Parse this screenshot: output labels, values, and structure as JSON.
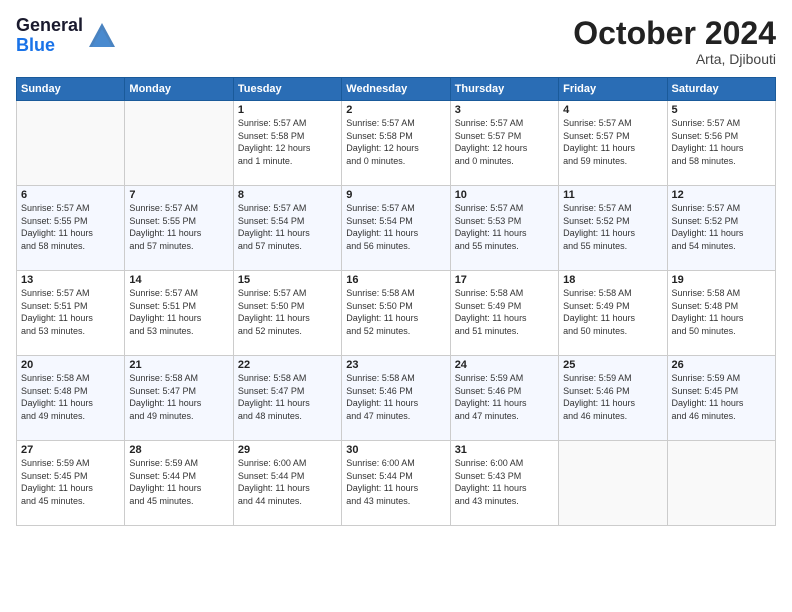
{
  "logo": {
    "line1": "General",
    "line2": "Blue"
  },
  "header": {
    "title": "October 2024",
    "location": "Arta, Djibouti"
  },
  "weekdays": [
    "Sunday",
    "Monday",
    "Tuesday",
    "Wednesday",
    "Thursday",
    "Friday",
    "Saturday"
  ],
  "weeks": [
    [
      {
        "day": "",
        "info": ""
      },
      {
        "day": "",
        "info": ""
      },
      {
        "day": "1",
        "info": "Sunrise: 5:57 AM\nSunset: 5:58 PM\nDaylight: 12 hours\nand 1 minute."
      },
      {
        "day": "2",
        "info": "Sunrise: 5:57 AM\nSunset: 5:58 PM\nDaylight: 12 hours\nand 0 minutes."
      },
      {
        "day": "3",
        "info": "Sunrise: 5:57 AM\nSunset: 5:57 PM\nDaylight: 12 hours\nand 0 minutes."
      },
      {
        "day": "4",
        "info": "Sunrise: 5:57 AM\nSunset: 5:57 PM\nDaylight: 11 hours\nand 59 minutes."
      },
      {
        "day": "5",
        "info": "Sunrise: 5:57 AM\nSunset: 5:56 PM\nDaylight: 11 hours\nand 58 minutes."
      }
    ],
    [
      {
        "day": "6",
        "info": "Sunrise: 5:57 AM\nSunset: 5:55 PM\nDaylight: 11 hours\nand 58 minutes."
      },
      {
        "day": "7",
        "info": "Sunrise: 5:57 AM\nSunset: 5:55 PM\nDaylight: 11 hours\nand 57 minutes."
      },
      {
        "day": "8",
        "info": "Sunrise: 5:57 AM\nSunset: 5:54 PM\nDaylight: 11 hours\nand 57 minutes."
      },
      {
        "day": "9",
        "info": "Sunrise: 5:57 AM\nSunset: 5:54 PM\nDaylight: 11 hours\nand 56 minutes."
      },
      {
        "day": "10",
        "info": "Sunrise: 5:57 AM\nSunset: 5:53 PM\nDaylight: 11 hours\nand 55 minutes."
      },
      {
        "day": "11",
        "info": "Sunrise: 5:57 AM\nSunset: 5:52 PM\nDaylight: 11 hours\nand 55 minutes."
      },
      {
        "day": "12",
        "info": "Sunrise: 5:57 AM\nSunset: 5:52 PM\nDaylight: 11 hours\nand 54 minutes."
      }
    ],
    [
      {
        "day": "13",
        "info": "Sunrise: 5:57 AM\nSunset: 5:51 PM\nDaylight: 11 hours\nand 53 minutes."
      },
      {
        "day": "14",
        "info": "Sunrise: 5:57 AM\nSunset: 5:51 PM\nDaylight: 11 hours\nand 53 minutes."
      },
      {
        "day": "15",
        "info": "Sunrise: 5:57 AM\nSunset: 5:50 PM\nDaylight: 11 hours\nand 52 minutes."
      },
      {
        "day": "16",
        "info": "Sunrise: 5:58 AM\nSunset: 5:50 PM\nDaylight: 11 hours\nand 52 minutes."
      },
      {
        "day": "17",
        "info": "Sunrise: 5:58 AM\nSunset: 5:49 PM\nDaylight: 11 hours\nand 51 minutes."
      },
      {
        "day": "18",
        "info": "Sunrise: 5:58 AM\nSunset: 5:49 PM\nDaylight: 11 hours\nand 50 minutes."
      },
      {
        "day": "19",
        "info": "Sunrise: 5:58 AM\nSunset: 5:48 PM\nDaylight: 11 hours\nand 50 minutes."
      }
    ],
    [
      {
        "day": "20",
        "info": "Sunrise: 5:58 AM\nSunset: 5:48 PM\nDaylight: 11 hours\nand 49 minutes."
      },
      {
        "day": "21",
        "info": "Sunrise: 5:58 AM\nSunset: 5:47 PM\nDaylight: 11 hours\nand 49 minutes."
      },
      {
        "day": "22",
        "info": "Sunrise: 5:58 AM\nSunset: 5:47 PM\nDaylight: 11 hours\nand 48 minutes."
      },
      {
        "day": "23",
        "info": "Sunrise: 5:58 AM\nSunset: 5:46 PM\nDaylight: 11 hours\nand 47 minutes."
      },
      {
        "day": "24",
        "info": "Sunrise: 5:59 AM\nSunset: 5:46 PM\nDaylight: 11 hours\nand 47 minutes."
      },
      {
        "day": "25",
        "info": "Sunrise: 5:59 AM\nSunset: 5:46 PM\nDaylight: 11 hours\nand 46 minutes."
      },
      {
        "day": "26",
        "info": "Sunrise: 5:59 AM\nSunset: 5:45 PM\nDaylight: 11 hours\nand 46 minutes."
      }
    ],
    [
      {
        "day": "27",
        "info": "Sunrise: 5:59 AM\nSunset: 5:45 PM\nDaylight: 11 hours\nand 45 minutes."
      },
      {
        "day": "28",
        "info": "Sunrise: 5:59 AM\nSunset: 5:44 PM\nDaylight: 11 hours\nand 45 minutes."
      },
      {
        "day": "29",
        "info": "Sunrise: 6:00 AM\nSunset: 5:44 PM\nDaylight: 11 hours\nand 44 minutes."
      },
      {
        "day": "30",
        "info": "Sunrise: 6:00 AM\nSunset: 5:44 PM\nDaylight: 11 hours\nand 43 minutes."
      },
      {
        "day": "31",
        "info": "Sunrise: 6:00 AM\nSunset: 5:43 PM\nDaylight: 11 hours\nand 43 minutes."
      },
      {
        "day": "",
        "info": ""
      },
      {
        "day": "",
        "info": ""
      }
    ]
  ]
}
